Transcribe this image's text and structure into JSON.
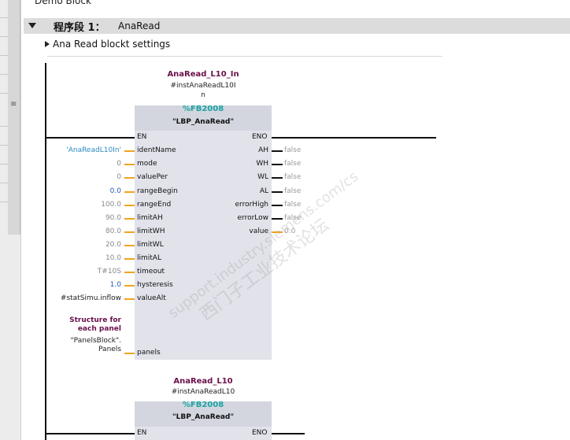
{
  "breadcrumb": "Demo Block",
  "segment": {
    "label": "程序段 1：",
    "name": "AnaRead"
  },
  "segment_title": "Ana Read blockt settings",
  "block1": {
    "instance_name": "AnaRead_L10_In",
    "instance_db_line1": "#instAnaReadL10I",
    "instance_db_line2": "n",
    "fb_number": "%FB2008",
    "fb_name": "\"LBP_AnaRead\"",
    "en": "EN",
    "eno": "ENO",
    "inputs": [
      {
        "pin": "identName",
        "value": "'AnaReadL10In'"
      },
      {
        "pin": "mode",
        "value": "0"
      },
      {
        "pin": "valuePer",
        "value": "0"
      },
      {
        "pin": "rangeBegin",
        "value": "0.0"
      },
      {
        "pin": "rangeEnd",
        "value": "100.0"
      },
      {
        "pin": "limitAH",
        "value": "90.0"
      },
      {
        "pin": "limitWH",
        "value": "80.0"
      },
      {
        "pin": "limitWL",
        "value": "20.0"
      },
      {
        "pin": "limitAL",
        "value": "10.0"
      },
      {
        "pin": "timeout",
        "value": "T#10S"
      },
      {
        "pin": "hysteresis",
        "value": "1.0"
      },
      {
        "pin": "valueAlt",
        "value": "#statSimu.inflow"
      }
    ],
    "outputs": [
      {
        "pin": "AH",
        "value": "false"
      },
      {
        "pin": "WH",
        "value": "false"
      },
      {
        "pin": "WL",
        "value": "false"
      },
      {
        "pin": "AL",
        "value": "false"
      },
      {
        "pin": "errorHigh",
        "value": "false"
      },
      {
        "pin": "errorLow",
        "value": "false"
      },
      {
        "pin": "value",
        "value": "0.0"
      }
    ],
    "panels_comment_line1": "Structure for",
    "panels_comment_line2": "each panel",
    "panels_value_line1": "\"PanelsBlock\".",
    "panels_value_line2": "Panels",
    "panels_pin": "panels"
  },
  "block2": {
    "instance_name": "AnaRead_L10",
    "instance_db": "#instAnaReadL10",
    "fb_number": "%FB2008",
    "fb_name": "\"LBP_AnaRead\"",
    "en": "EN",
    "eno": "ENO"
  },
  "watermark": {
    "line1": "西门子工业技术论坛",
    "line2": "support.industry.siemens.com/cs"
  },
  "colors": {
    "wire_accent": "#f0a41e",
    "fb_number": "#17a3a3",
    "instance_name": "#6a0f4a",
    "block_fill": "#e1e2ea"
  }
}
